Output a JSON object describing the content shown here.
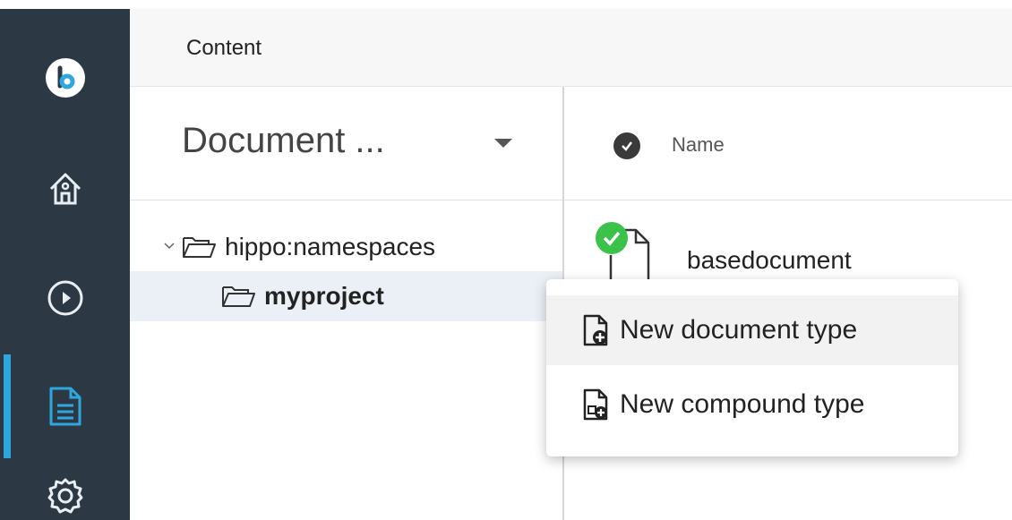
{
  "topbar": {
    "title": "Content"
  },
  "left_panel": {
    "selector_label": "Document ...",
    "tree": [
      {
        "label": "hippo:namespaces",
        "expanded": true
      },
      {
        "label": "myproject",
        "selected": true
      }
    ]
  },
  "list": {
    "column_name": "Name",
    "rows": [
      {
        "name": "basedocument",
        "status": "published"
      }
    ]
  },
  "context_menu": {
    "items": [
      {
        "label": "New document type"
      },
      {
        "label": "New compound type"
      }
    ]
  },
  "nav": {
    "items": [
      "logo-icon",
      "home-icon",
      "play-circle-icon",
      "document-icon",
      "gear-icon"
    ],
    "active": "document-icon"
  },
  "colors": {
    "nav_bg": "#2c3945",
    "accent": "#2fa7dd",
    "status_green": "#3bc24a",
    "selected_row": "#eaf0f6"
  }
}
